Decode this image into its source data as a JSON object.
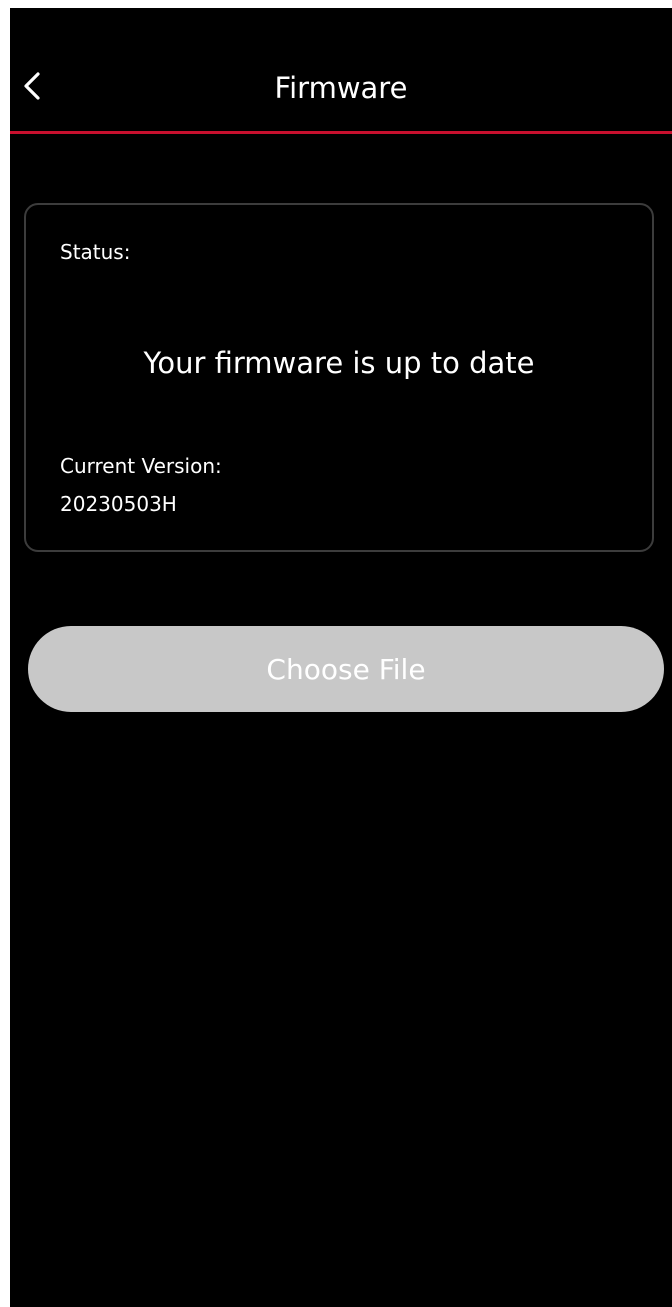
{
  "nav": {
    "title": "Firmware",
    "back_icon": "chevron-left-icon",
    "divider_color": "#c8102e"
  },
  "status_card": {
    "status_label": "Status:",
    "status_message": "Your firmware is up to date",
    "version_label": "Current Version:",
    "version_value": "20230503H"
  },
  "actions": {
    "choose_file_label": "Choose File"
  },
  "colors": {
    "background": "#000000",
    "text": "#ffffff",
    "button_disabled": "#c8c8c8",
    "card_border": "#3c3c3c"
  }
}
